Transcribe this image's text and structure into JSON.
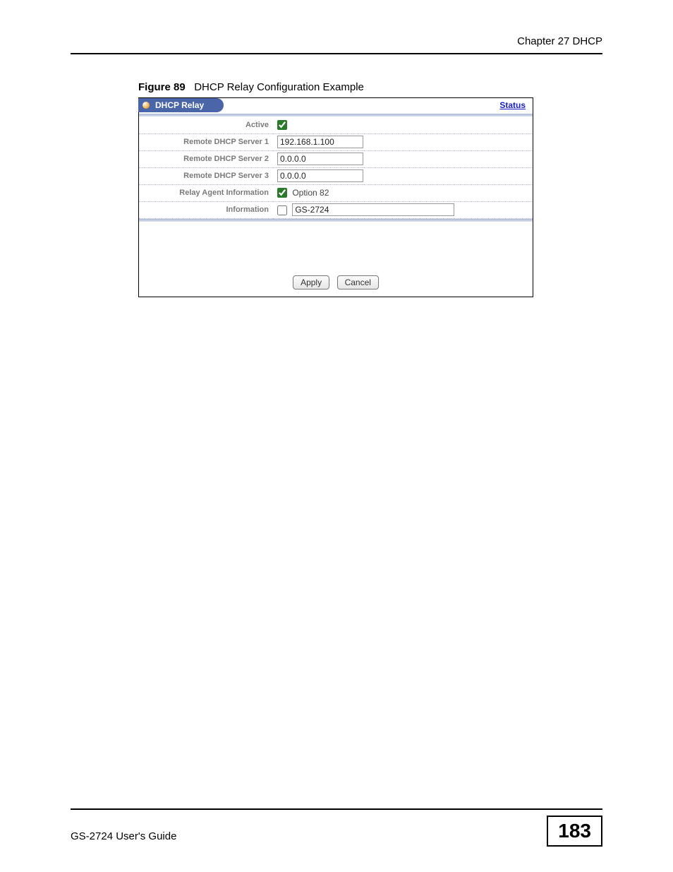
{
  "header": {
    "chapter": "Chapter 27 DHCP"
  },
  "figure": {
    "number": "Figure 89",
    "title": "DHCP Relay Configuration Example"
  },
  "panel": {
    "title": "DHCP Relay",
    "status_link": "Status",
    "rows": {
      "active": {
        "label": "Active",
        "checked": true
      },
      "server1": {
        "label": "Remote DHCP Server 1",
        "value": "192.168.1.100"
      },
      "server2": {
        "label": "Remote DHCP Server 2",
        "value": "0.0.0.0"
      },
      "server3": {
        "label": "Remote DHCP Server 3",
        "value": "0.0.0.0"
      },
      "relay_agent": {
        "label": "Relay Agent Information",
        "option_label": "Option 82",
        "checked": true
      },
      "information": {
        "label": "Information",
        "checked": false,
        "value": "GS-2724"
      }
    },
    "buttons": {
      "apply": "Apply",
      "cancel": "Cancel"
    }
  },
  "footer": {
    "guide": "GS-2724 User's Guide",
    "page": "183"
  }
}
